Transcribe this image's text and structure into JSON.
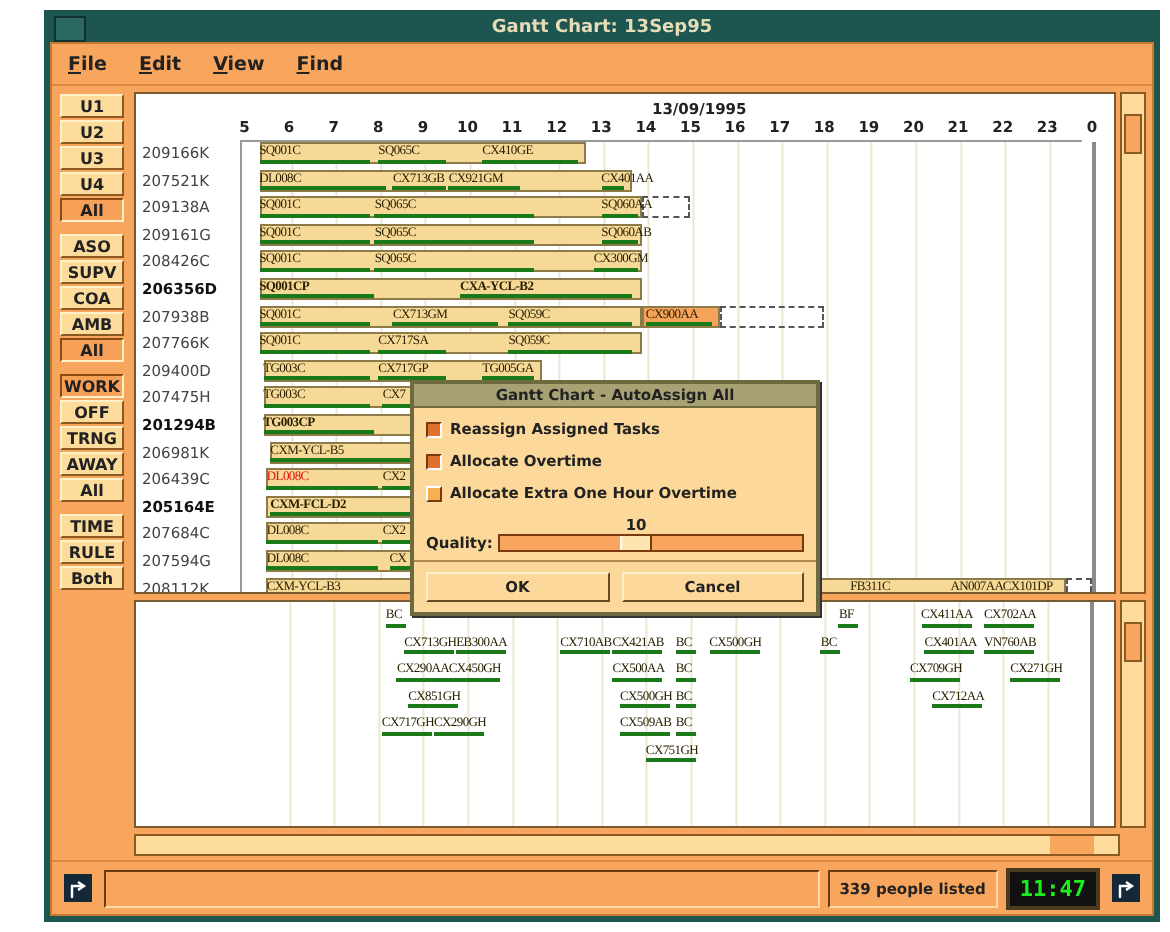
{
  "window": {
    "title": "Gantt Chart: 13Sep95"
  },
  "menu": [
    "File",
    "Edit",
    "View",
    "Find"
  ],
  "filters": [
    {
      "buttons": [
        {
          "label": "U1",
          "selected": false
        },
        {
          "label": "U2",
          "selected": false
        },
        {
          "label": "U3",
          "selected": false
        },
        {
          "label": "U4",
          "selected": false
        },
        {
          "label": "All",
          "selected": true
        }
      ]
    },
    {
      "buttons": [
        {
          "label": "ASO",
          "selected": false
        },
        {
          "label": "SUPV",
          "selected": false
        },
        {
          "label": "COA",
          "selected": false
        },
        {
          "label": "AMB",
          "selected": false
        },
        {
          "label": "All",
          "selected": true
        }
      ]
    },
    {
      "buttons": [
        {
          "label": "WORK",
          "selected": true
        },
        {
          "label": "OFF",
          "selected": false
        },
        {
          "label": "TRNG",
          "selected": false
        },
        {
          "label": "AWAY",
          "selected": false
        },
        {
          "label": "All",
          "selected": false
        }
      ]
    },
    {
      "buttons": [
        {
          "label": "TIME",
          "selected": false
        },
        {
          "label": "RULE",
          "selected": false
        },
        {
          "label": "Both",
          "selected": false
        }
      ]
    }
  ],
  "timeline": {
    "date": "13/09/1995",
    "hours": [
      "5",
      "6",
      "7",
      "8",
      "9",
      "10",
      "11",
      "12",
      "13",
      "14",
      "15",
      "16",
      "17",
      "18",
      "19",
      "20",
      "21",
      "22",
      "23",
      "0"
    ]
  },
  "rows": [
    {
      "name": "209166K",
      "emphasized": false,
      "tasks": [
        {
          "label": "SQ001C"
        },
        {
          "label": "SQ065C"
        },
        {
          "label": "CX410GE"
        }
      ]
    },
    {
      "name": "207521K",
      "emphasized": false,
      "tasks": [
        {
          "label": "DL008C"
        },
        {
          "label": "CX713GB"
        },
        {
          "label": "CX921GM"
        },
        {
          "label": "CX401AA"
        }
      ]
    },
    {
      "name": "209138A",
      "emphasized": false,
      "tasks": [
        {
          "label": "SQ001C"
        },
        {
          "label": "SQ065C"
        },
        {
          "label": "SQ060AA"
        }
      ]
    },
    {
      "name": "209161G",
      "emphasized": false,
      "tasks": [
        {
          "label": "SQ001C"
        },
        {
          "label": "SQ065C"
        },
        {
          "label": "SQ060AB"
        }
      ]
    },
    {
      "name": "208426C",
      "emphasized": false,
      "tasks": [
        {
          "label": "SQ001C"
        },
        {
          "label": "SQ065C"
        },
        {
          "label": "CX300GM"
        }
      ]
    },
    {
      "name": "206356D",
      "emphasized": true,
      "tasks": [
        {
          "label": "SQ001CP"
        },
        {
          "label": "CXA-YCL-B2"
        }
      ]
    },
    {
      "name": "207938B",
      "emphasized": false,
      "tasks": [
        {
          "label": "SQ001C"
        },
        {
          "label": "CX713GM"
        },
        {
          "label": "SQ059C"
        },
        {
          "label": "CX900AA",
          "highlighted": true
        }
      ]
    },
    {
      "name": "207766K",
      "emphasized": false,
      "tasks": [
        {
          "label": "SQ001C"
        },
        {
          "label": "CX717SA"
        },
        {
          "label": "SQ059C"
        }
      ]
    },
    {
      "name": "209400D",
      "emphasized": false,
      "tasks": [
        {
          "label": "TG003C"
        },
        {
          "label": "CX717GP"
        },
        {
          "label": "TG005GA"
        }
      ]
    },
    {
      "name": "207475H",
      "emphasized": false,
      "tasks": [
        {
          "label": "TG003C"
        },
        {
          "label": "CX7"
        }
      ]
    },
    {
      "name": "201294B",
      "emphasized": true,
      "tasks": [
        {
          "label": "TG003CP"
        }
      ]
    },
    {
      "name": "206981K",
      "emphasized": false,
      "tasks": [
        {
          "label": "CXM-YCL-B5"
        }
      ]
    },
    {
      "name": "206439C",
      "emphasized": false,
      "tasks": [
        {
          "label": "DL008C",
          "flagged": true
        },
        {
          "label": "CX2"
        }
      ]
    },
    {
      "name": "205164E",
      "emphasized": true,
      "tasks": [
        {
          "label": "CXM-FCL-D2"
        }
      ]
    },
    {
      "name": "207684C",
      "emphasized": false,
      "tasks": [
        {
          "label": "DL008C"
        },
        {
          "label": "CX2"
        }
      ]
    },
    {
      "name": "207594G",
      "emphasized": false,
      "tasks": [
        {
          "label": "DL008C"
        },
        {
          "label": "CX"
        }
      ]
    },
    {
      "name": "208112K",
      "emphasized": false,
      "tasks": [
        {
          "label": "CXM-YCL-B3"
        },
        {
          "label": "FB311C"
        },
        {
          "label": "AN007AA"
        },
        {
          "label": "CX101DP"
        }
      ]
    }
  ],
  "unassigned": [
    [
      "BC",
      "BF",
      "CX411AA",
      "CX702AA"
    ],
    [
      "CX713GH",
      "EB300AA",
      "CX710AB",
      "CX421AB",
      "BC",
      "CX500GH",
      "BC",
      "CX401AA",
      "VN760AB"
    ],
    [
      "CX290AA",
      "CX450GH",
      "CX500AA",
      "BC",
      "CX709GH",
      "CX271GH"
    ],
    [
      "CX851GH",
      "CX500GH",
      "BC",
      "CX712AA"
    ],
    [
      "CX717GH",
      "CX290GH",
      "CX509AB",
      "BC"
    ],
    [
      "CX751GH"
    ]
  ],
  "dialog": {
    "title": "Gantt Chart - AutoAssign All",
    "options": [
      {
        "label": "Reassign Assigned Tasks",
        "checked": true
      },
      {
        "label": "Allocate Overtime",
        "checked": true
      },
      {
        "label": "Allocate Extra One Hour Overtime",
        "checked": false
      }
    ],
    "quality": {
      "label": "Quality:",
      "value": "10",
      "level": 0.45
    },
    "buttons": [
      "OK",
      "Cancel"
    ]
  },
  "status_bar": {
    "count": "339 people listed",
    "clock": "11:47"
  }
}
